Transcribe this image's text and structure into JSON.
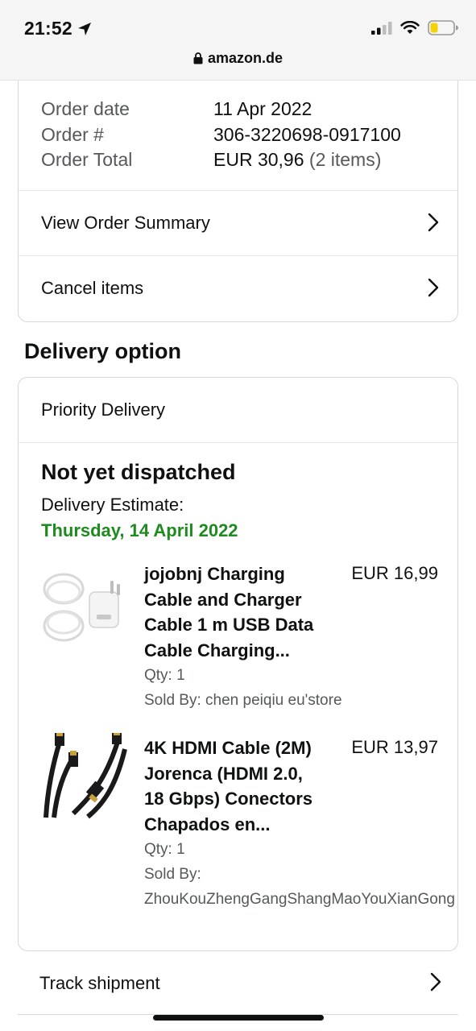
{
  "status_bar": {
    "time": "21:52"
  },
  "browser": {
    "domain": "amazon.de"
  },
  "order": {
    "rows": [
      {
        "label": "Order date",
        "value": "11 Apr 2022"
      },
      {
        "label": "Order #",
        "value": "306-3220698-0917100"
      }
    ],
    "total_label": "Order Total",
    "total_value": "EUR 30,96",
    "total_items": "(2 items)",
    "view_summary": "View Order Summary",
    "cancel_items": "Cancel items"
  },
  "delivery": {
    "section_title": "Delivery option",
    "option": "Priority Delivery",
    "status": "Not yet dispatched",
    "estimate_label": "Delivery Estimate:",
    "estimate_date": "Thursday, 14 April 2022",
    "items": [
      {
        "title_lines": [
          "jojobnj Charging",
          "Cable and Charger",
          "Cable 1 m USB Data",
          "Cable Charging..."
        ],
        "price": "EUR 16,99",
        "qty": "Qty: 1",
        "sold_by": "Sold By: chen peiqiu eu'store"
      },
      {
        "title_lines": [
          "4K HDMI Cable (2M)",
          "Jorenca (HDMI 2.0,",
          "18 Gbps) Conectors",
          "Chapados en..."
        ],
        "price": "EUR 13,97",
        "qty": "Qty: 1",
        "sold_by_label": "Sold By:",
        "sold_by_value": "ZhouKouZhengGangShangMaoYouXianGong"
      }
    ]
  },
  "track_shipment": "Track shipment",
  "colors": {
    "accent_green": "#1f8a1f",
    "border": "#d5d9d9",
    "text": "#0f1111",
    "muted": "#565959"
  },
  "icons": [
    "location-arrow-icon",
    "cellular-signal-icon",
    "wifi-icon",
    "battery-icon",
    "lock-icon",
    "chevron-right-icon"
  ]
}
